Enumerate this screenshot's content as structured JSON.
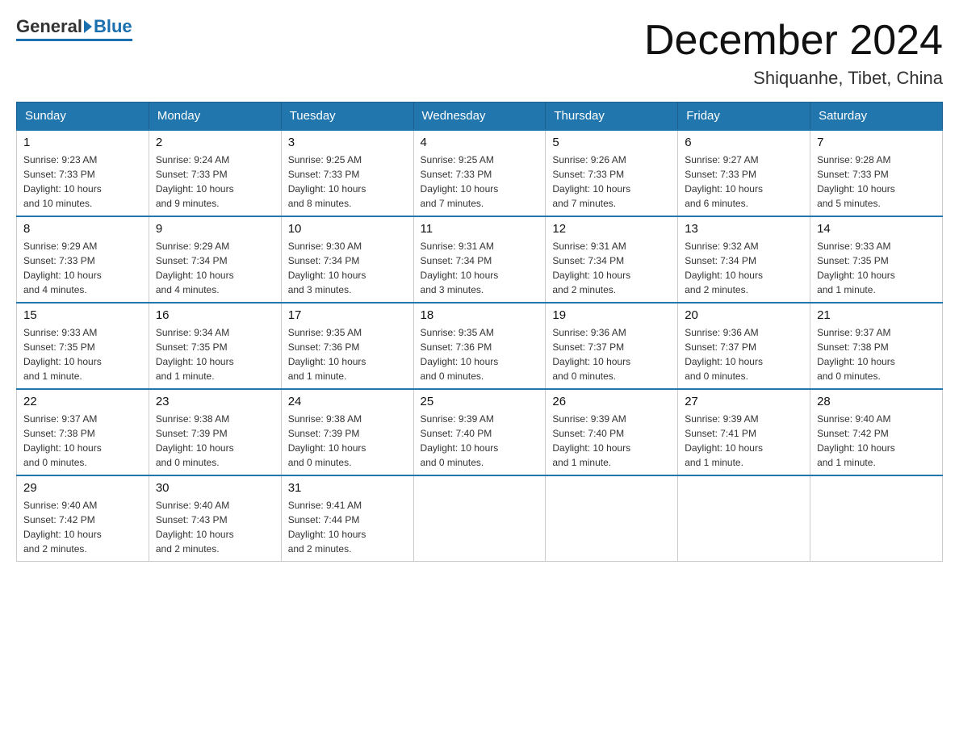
{
  "logo": {
    "general": "General",
    "blue": "Blue"
  },
  "title": "December 2024",
  "subtitle": "Shiquanhe, Tibet, China",
  "headers": [
    "Sunday",
    "Monday",
    "Tuesday",
    "Wednesday",
    "Thursday",
    "Friday",
    "Saturday"
  ],
  "weeks": [
    [
      {
        "day": "1",
        "sunrise": "9:23 AM",
        "sunset": "7:33 PM",
        "daylight": "10 hours and 10 minutes."
      },
      {
        "day": "2",
        "sunrise": "9:24 AM",
        "sunset": "7:33 PM",
        "daylight": "10 hours and 9 minutes."
      },
      {
        "day": "3",
        "sunrise": "9:25 AM",
        "sunset": "7:33 PM",
        "daylight": "10 hours and 8 minutes."
      },
      {
        "day": "4",
        "sunrise": "9:25 AM",
        "sunset": "7:33 PM",
        "daylight": "10 hours and 7 minutes."
      },
      {
        "day": "5",
        "sunrise": "9:26 AM",
        "sunset": "7:33 PM",
        "daylight": "10 hours and 7 minutes."
      },
      {
        "day": "6",
        "sunrise": "9:27 AM",
        "sunset": "7:33 PM",
        "daylight": "10 hours and 6 minutes."
      },
      {
        "day": "7",
        "sunrise": "9:28 AM",
        "sunset": "7:33 PM",
        "daylight": "10 hours and 5 minutes."
      }
    ],
    [
      {
        "day": "8",
        "sunrise": "9:29 AM",
        "sunset": "7:33 PM",
        "daylight": "10 hours and 4 minutes."
      },
      {
        "day": "9",
        "sunrise": "9:29 AM",
        "sunset": "7:34 PM",
        "daylight": "10 hours and 4 minutes."
      },
      {
        "day": "10",
        "sunrise": "9:30 AM",
        "sunset": "7:34 PM",
        "daylight": "10 hours and 3 minutes."
      },
      {
        "day": "11",
        "sunrise": "9:31 AM",
        "sunset": "7:34 PM",
        "daylight": "10 hours and 3 minutes."
      },
      {
        "day": "12",
        "sunrise": "9:31 AM",
        "sunset": "7:34 PM",
        "daylight": "10 hours and 2 minutes."
      },
      {
        "day": "13",
        "sunrise": "9:32 AM",
        "sunset": "7:34 PM",
        "daylight": "10 hours and 2 minutes."
      },
      {
        "day": "14",
        "sunrise": "9:33 AM",
        "sunset": "7:35 PM",
        "daylight": "10 hours and 1 minute."
      }
    ],
    [
      {
        "day": "15",
        "sunrise": "9:33 AM",
        "sunset": "7:35 PM",
        "daylight": "10 hours and 1 minute."
      },
      {
        "day": "16",
        "sunrise": "9:34 AM",
        "sunset": "7:35 PM",
        "daylight": "10 hours and 1 minute."
      },
      {
        "day": "17",
        "sunrise": "9:35 AM",
        "sunset": "7:36 PM",
        "daylight": "10 hours and 1 minute."
      },
      {
        "day": "18",
        "sunrise": "9:35 AM",
        "sunset": "7:36 PM",
        "daylight": "10 hours and 0 minutes."
      },
      {
        "day": "19",
        "sunrise": "9:36 AM",
        "sunset": "7:37 PM",
        "daylight": "10 hours and 0 minutes."
      },
      {
        "day": "20",
        "sunrise": "9:36 AM",
        "sunset": "7:37 PM",
        "daylight": "10 hours and 0 minutes."
      },
      {
        "day": "21",
        "sunrise": "9:37 AM",
        "sunset": "7:38 PM",
        "daylight": "10 hours and 0 minutes."
      }
    ],
    [
      {
        "day": "22",
        "sunrise": "9:37 AM",
        "sunset": "7:38 PM",
        "daylight": "10 hours and 0 minutes."
      },
      {
        "day": "23",
        "sunrise": "9:38 AM",
        "sunset": "7:39 PM",
        "daylight": "10 hours and 0 minutes."
      },
      {
        "day": "24",
        "sunrise": "9:38 AM",
        "sunset": "7:39 PM",
        "daylight": "10 hours and 0 minutes."
      },
      {
        "day": "25",
        "sunrise": "9:39 AM",
        "sunset": "7:40 PM",
        "daylight": "10 hours and 0 minutes."
      },
      {
        "day": "26",
        "sunrise": "9:39 AM",
        "sunset": "7:40 PM",
        "daylight": "10 hours and 1 minute."
      },
      {
        "day": "27",
        "sunrise": "9:39 AM",
        "sunset": "7:41 PM",
        "daylight": "10 hours and 1 minute."
      },
      {
        "day": "28",
        "sunrise": "9:40 AM",
        "sunset": "7:42 PM",
        "daylight": "10 hours and 1 minute."
      }
    ],
    [
      {
        "day": "29",
        "sunrise": "9:40 AM",
        "sunset": "7:42 PM",
        "daylight": "10 hours and 2 minutes."
      },
      {
        "day": "30",
        "sunrise": "9:40 AM",
        "sunset": "7:43 PM",
        "daylight": "10 hours and 2 minutes."
      },
      {
        "day": "31",
        "sunrise": "9:41 AM",
        "sunset": "7:44 PM",
        "daylight": "10 hours and 2 minutes."
      },
      null,
      null,
      null,
      null
    ]
  ],
  "labels": {
    "sunrise": "Sunrise:",
    "sunset": "Sunset:",
    "daylight": "Daylight:"
  }
}
